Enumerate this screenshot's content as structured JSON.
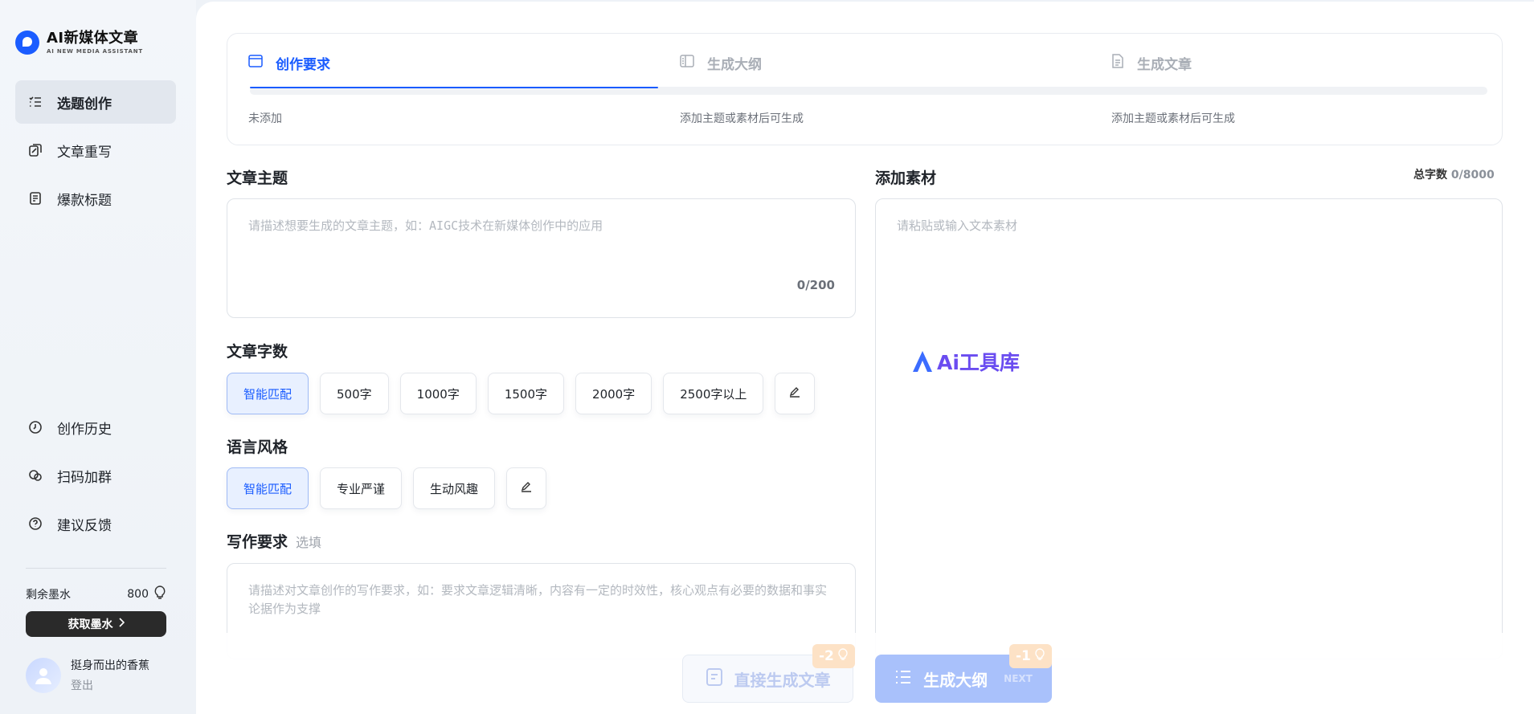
{
  "brand": {
    "title": "AI新媒体文章",
    "subtitle": "AI NEW MEDIA ASSISTANT"
  },
  "nav_top": [
    {
      "label": "选题创作",
      "icon": "list-icon",
      "active": true
    },
    {
      "label": "文章重写",
      "icon": "rewrite-icon",
      "active": false
    },
    {
      "label": "爆款标题",
      "icon": "document-icon",
      "active": false
    }
  ],
  "nav_bottom": [
    {
      "label": "创作历史",
      "icon": "clock-icon"
    },
    {
      "label": "扫码加群",
      "icon": "group-icon"
    },
    {
      "label": "建议反馈",
      "icon": "question-icon"
    }
  ],
  "ink": {
    "label": "剩余墨水",
    "value": "800",
    "button_label": "获取墨水"
  },
  "user": {
    "name": "挺身而出的香蕉",
    "logout": "登出"
  },
  "steps": [
    {
      "title": "创作要求",
      "desc": "未添加",
      "active": true,
      "icon": "window-icon"
    },
    {
      "title": "生成大纲",
      "desc": "添加主题或素材后可生成",
      "active": false,
      "icon": "outline-icon"
    },
    {
      "title": "生成文章",
      "desc": "添加主题或素材后可生成",
      "active": false,
      "icon": "article-icon"
    }
  ],
  "progress": 0.33,
  "topic": {
    "title": "文章主题",
    "placeholder": "请描述想要生成的文章主题，如：AIGC技术在新媒体创作中的应用",
    "counter": "0/200"
  },
  "word_count": {
    "title": "文章字数",
    "options": [
      "智能匹配",
      "500字",
      "1000字",
      "1500字",
      "2000字",
      "2500字以上"
    ],
    "selected": "智能匹配"
  },
  "style": {
    "title": "语言风格",
    "options": [
      "智能匹配",
      "专业严谨",
      "生动风趣"
    ],
    "selected": "智能匹配"
  },
  "requirements": {
    "title": "写作要求",
    "optional": "选填",
    "placeholder": "请描述对文章创作的写作要求，如：要求文章逻辑清晰，内容有一定的时效性，核心观点有必要的数据和事实论据作为支撑"
  },
  "material": {
    "title": "添加素材",
    "total_label": "总字数",
    "total_value": "0/8000",
    "placeholder": "请粘贴或输入文本素材"
  },
  "watermark": "Ai工具库",
  "actions": {
    "direct": {
      "label": "直接生成文章",
      "cost": "-2"
    },
    "outline": {
      "label": "生成大纲",
      "next": "NEXT",
      "cost": "-1"
    }
  },
  "colors": {
    "accent": "#1a5cff",
    "sidebar_bg": "#eef2f7",
    "cost_badge": "#fde2c6"
  }
}
